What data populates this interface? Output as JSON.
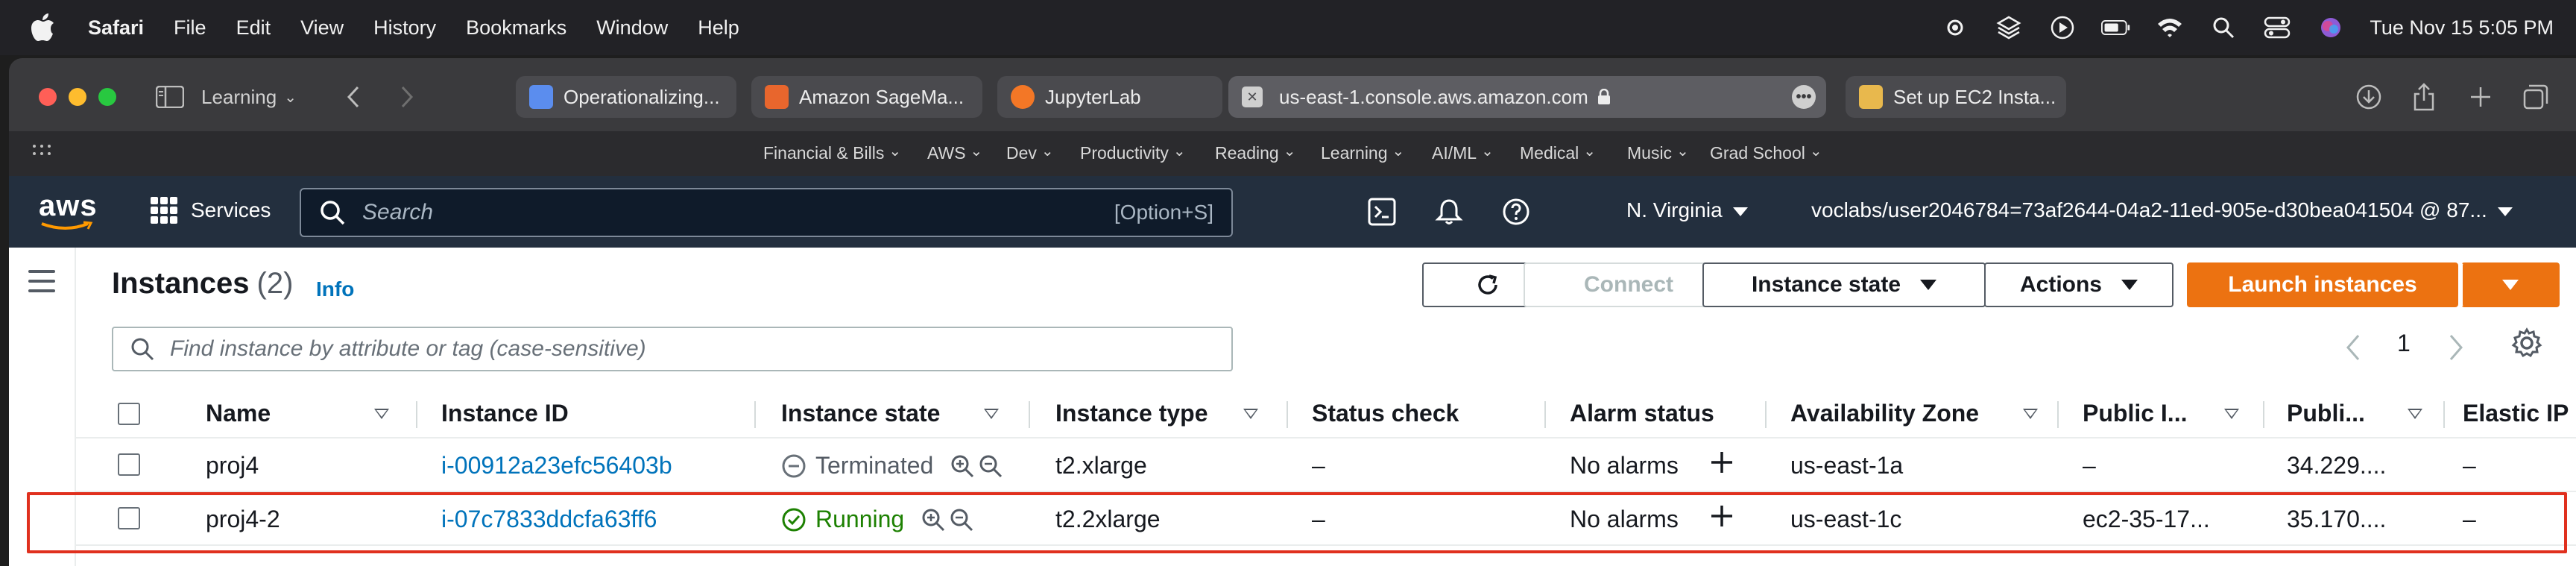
{
  "menubar": {
    "app": "Safari",
    "items": [
      "File",
      "Edit",
      "View",
      "History",
      "Bookmarks",
      "Window",
      "Help"
    ],
    "clock": "Tue Nov 15  5:05 PM"
  },
  "safari": {
    "tab_group": "Learning",
    "tabs": [
      {
        "title": "Operationalizing...",
        "favicon_color": "#5b8dee"
      },
      {
        "title": "Amazon SageMa...",
        "favicon_color": "#e8662d"
      },
      {
        "title": "JupyterLab",
        "favicon_color": "#f37726"
      },
      {
        "title": "us-east-1.console.aws.amazon.com",
        "active": true
      },
      {
        "title": "Set up EC2 Insta...",
        "favicon_color": "#e8b84d"
      }
    ],
    "bookmarks": [
      "Financial & Bills",
      "AWS",
      "Dev",
      "Productivity",
      "Reading",
      "Learning",
      "AI/ML",
      "Medical",
      "Music",
      "Grad School"
    ]
  },
  "aws_header": {
    "logo": "aws",
    "services_label": "Services",
    "search_placeholder": "Search",
    "search_shortcut": "[Option+S]",
    "region": "N. Virginia",
    "account": "voclabs/user2046784=73af2644-04a2-11ed-905e-d30bea041504 @ 87..."
  },
  "instances_panel": {
    "title": "Instances",
    "count": "(2)",
    "info": "Info",
    "buttons": {
      "connect": "Connect",
      "instance_state": "Instance state",
      "actions": "Actions",
      "launch": "Launch instances"
    },
    "filter_placeholder": "Find instance by attribute or tag (case-sensitive)",
    "page": "1"
  },
  "table": {
    "columns": [
      "Name",
      "Instance ID",
      "Instance state",
      "Instance type",
      "Status check",
      "Alarm status",
      "Availability Zone",
      "Public I...",
      "Publi...",
      "Elastic IP"
    ],
    "rows": [
      {
        "name": "proj4",
        "id": "i-00912a23efc56403b",
        "state": "Terminated",
        "type": "t2.xlarge",
        "status_check": "–",
        "alarm": "No alarms",
        "az": "us-east-1a",
        "public_dns": "–",
        "public_ip": "34.229....",
        "elastic_ip": "–"
      },
      {
        "name": "proj4-2",
        "id": "i-07c7833ddcfa63ff6",
        "state": "Running",
        "type": "t2.2xlarge",
        "status_check": "–",
        "alarm": "No alarms",
        "az": "us-east-1c",
        "public_dns": "ec2-35-17...",
        "public_ip": "35.170....",
        "elastic_ip": "–"
      }
    ]
  },
  "colors": {
    "aws_header": "#232f3e",
    "primary_button": "#ec7211",
    "link": "#0073bb",
    "running": "#1d8102",
    "highlight": "#e0301e"
  }
}
